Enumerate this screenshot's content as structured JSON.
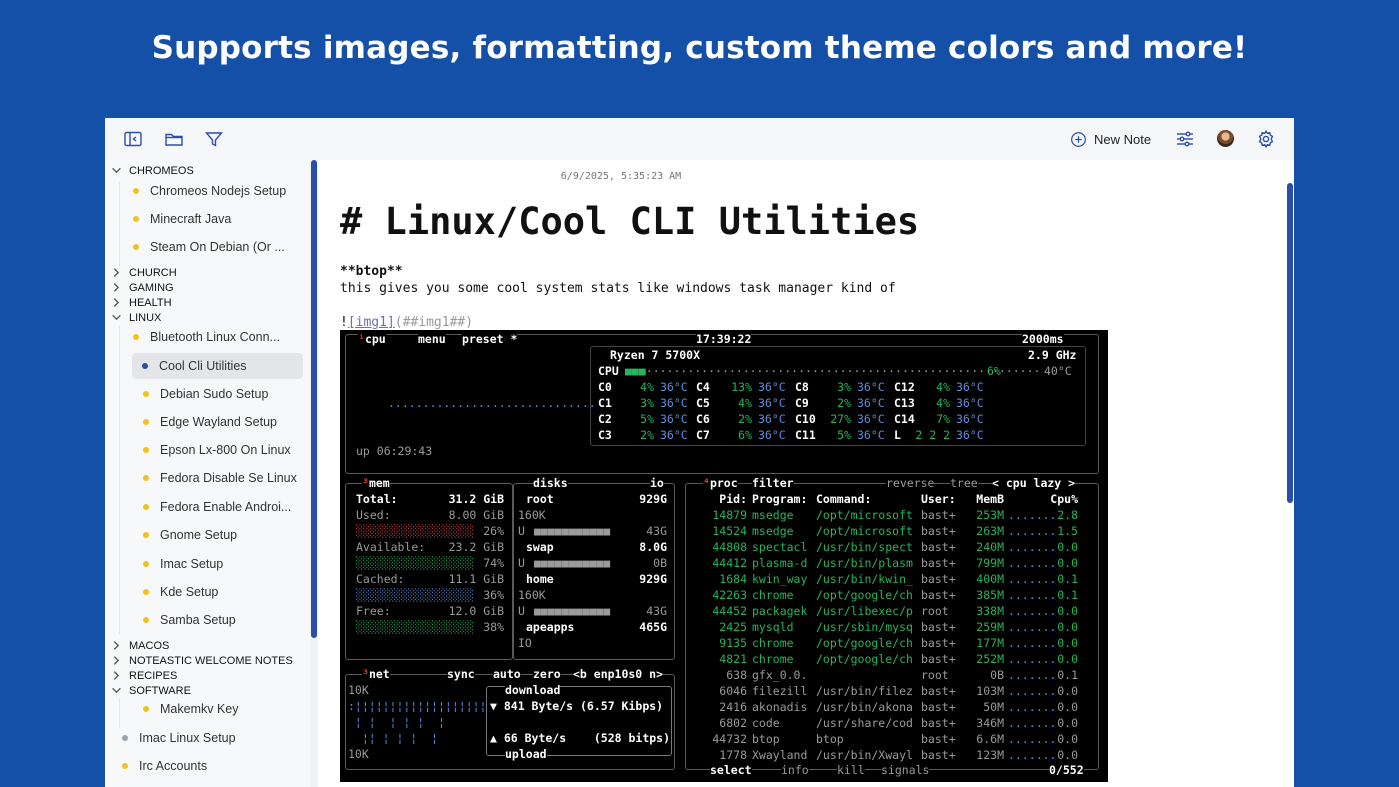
{
  "headline": "Supports images, formatting, custom theme colors and more!",
  "toolbar": {
    "new_note_label": "New Note"
  },
  "sidebar": {
    "folders": {
      "chromeos": "CHROMEOS",
      "church": "CHURCH",
      "gaming": "GAMING",
      "health": "HEALTH",
      "linux": "LINUX",
      "macos": "MACOS",
      "welcome": "NOTEASTIC WELCOME NOTES",
      "recipes": "RECIPES",
      "software": "SOFTWARE"
    },
    "chromeos_notes": [
      "Chromeos Nodejs Setup",
      "Minecraft Java",
      "Steam On Debian (Or ..."
    ],
    "linux_notes": [
      "Bluetooth Linux Conn...",
      "Cool Cli Utilities",
      "Debian Sudo Setup",
      "Edge Wayland Setup",
      "Epson Lx-800 On Linux",
      "Fedora Disable Se Linux",
      "Fedora Enable Androi...",
      "Gnome Setup",
      "Imac Setup",
      "Kde Setup",
      "Samba Setup"
    ],
    "software_notes": [
      "Makemkv Key"
    ],
    "root_notes": [
      "Imac Linux Setup",
      "Irc Accounts"
    ],
    "colors": {
      "yellow": "#f1c21b",
      "blue": "#2b4fa8",
      "gray": "#9aa3b0"
    }
  },
  "editor": {
    "date": "6/9/2025, 5:35:23 AM",
    "heading": "# Linux/Cool CLI Utilities",
    "bold_line": "**btop**",
    "paragraph": "this gives you some cool system stats like windows task manager kind of",
    "image_prefix": "!",
    "image_alt": "[img1]",
    "image_url": "(##img1##)"
  },
  "terminal": {
    "cpu_tabs": {
      "cpu": "cpu",
      "menu": "menu",
      "preset": "preset *"
    },
    "clock": "17:39:22",
    "refresh": "2000ms",
    "cpu_name": "Ryzen 7 5700X",
    "freq": "2.9 GHz",
    "cpu_total": "CPU",
    "cpu_total_pct": "6%",
    "cpu_temp": "40°C",
    "cores": [
      [
        "C0",
        "4%",
        "36°C",
        "C4",
        "13%",
        "36°C",
        "C8",
        "3%",
        "36°C",
        "C12",
        "4%",
        "36°C"
      ],
      [
        "C1",
        "3%",
        "36°C",
        "C5",
        "4%",
        "36°C",
        "C9",
        "2%",
        "36°C",
        "C13",
        "4%",
        "36°C"
      ],
      [
        "C2",
        "5%",
        "36°C",
        "C6",
        "2%",
        "36°C",
        "C10",
        "27%",
        "36°C",
        "C14",
        "7%",
        "36°C"
      ],
      [
        "C3",
        "2%",
        "36°C",
        "C7",
        "6%",
        "36°C",
        "C11",
        "5%",
        "36°C",
        "L",
        "2 2 2",
        "36°C"
      ]
    ],
    "uptime": "up 06:29:43",
    "mem": {
      "title": "mem",
      "rows": [
        [
          "Total:",
          "31.2 GiB"
        ],
        [
          "Used:",
          "8.00 GiB"
        ],
        [
          "",
          "26%"
        ],
        [
          "Available:",
          "23.2 GiB"
        ],
        [
          "",
          "74%"
        ],
        [
          "Cached:",
          "11.1 GiB"
        ],
        [
          "",
          "36%"
        ],
        [
          "Free:",
          "12.0 GiB"
        ],
        [
          "",
          "38%"
        ]
      ]
    },
    "disks": {
      "title": "disks",
      "io": "io",
      "rows": [
        [
          "root",
          "929G"
        ],
        [
          "160K",
          ""
        ],
        [
          "U",
          "43G"
        ],
        [
          "swap",
          "8.0G"
        ],
        [
          "U",
          "0B"
        ],
        [
          "home",
          "929G"
        ],
        [
          "160K",
          ""
        ],
        [
          "U",
          "43G"
        ],
        [
          "apeapps",
          "465G"
        ],
        [
          "IO",
          ""
        ]
      ]
    },
    "proc": {
      "title": "proc",
      "filter": "filter",
      "reverse": "reverse",
      "tree": "tree",
      "cpu_lazy": "< cpu lazy >",
      "headers": [
        "Pid:",
        "Program:",
        "Command:",
        "User:",
        "MemB",
        "Cpu%"
      ],
      "rows": [
        [
          "14879",
          "msedge",
          "/opt/microsoft",
          "bast+",
          "253M",
          "2.8"
        ],
        [
          "14524",
          "msedge",
          "/opt/microsoft",
          "bast+",
          "263M",
          "1.5"
        ],
        [
          "44808",
          "spectacl",
          "/usr/bin/spect",
          "bast+",
          "240M",
          "0.0"
        ],
        [
          "44412",
          "plasma-d",
          "/usr/bin/plasm",
          "bast+",
          "799M",
          "0.0"
        ],
        [
          "1684",
          "kwin_way",
          "/usr/bin/kwin_",
          "bast+",
          "400M",
          "0.1"
        ],
        [
          "42263",
          "chrome",
          "/opt/google/ch",
          "bast+",
          "385M",
          "0.1"
        ],
        [
          "44452",
          "packagek",
          "/usr/libexec/p",
          "root",
          "338M",
          "0.0"
        ],
        [
          "2425",
          "mysqld",
          "/usr/sbin/mysq",
          "bast+",
          "259M",
          "0.0"
        ],
        [
          "9135",
          "chrome",
          "/opt/google/ch",
          "bast+",
          "177M",
          "0.0"
        ],
        [
          "4821",
          "chrome",
          "/opt/google/ch",
          "bast+",
          "252M",
          "0.0"
        ],
        [
          "638",
          "gfx_0.0.",
          "",
          "root",
          "0B",
          "0.1"
        ],
        [
          "6046",
          "filezill",
          "/usr/bin/filez",
          "bast+",
          "103M",
          "0.0"
        ],
        [
          "2416",
          "akonadis",
          "/usr/bin/akona",
          "bast+",
          "50M",
          "0.0"
        ],
        [
          "6802",
          "code",
          "/usr/share/cod",
          "bast+",
          "346M",
          "0.0"
        ],
        [
          "44732",
          "btop",
          "btop",
          "bast+",
          "6.6M",
          "0.0"
        ],
        [
          "1778",
          "Xwayland",
          "/usr/bin/Xwayl",
          "bast+",
          "123M",
          "0.0"
        ]
      ],
      "footer_select": "select",
      "footer_info": "info",
      "footer_kill": "kill",
      "footer_signals": "signals",
      "footer_count": "0/552"
    },
    "net": {
      "title": "net",
      "sync": "sync",
      "auto": "auto",
      "zero": "zero",
      "iface": "<b enp10s0 n>",
      "scale_top": "10K",
      "scale_bottom": "10K",
      "download_label": "download",
      "download_rate": "▼ 841 Byte/s (6.57 Kibps)",
      "upload_rate": "▲ 66 Byte/s    (528 bitps)",
      "upload_label": "upload"
    }
  }
}
